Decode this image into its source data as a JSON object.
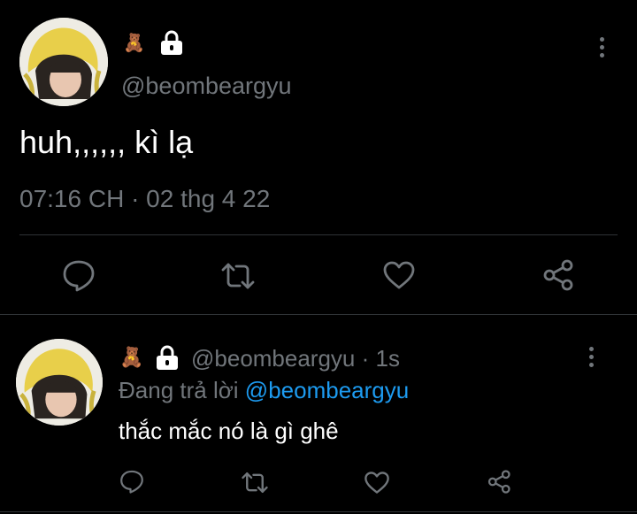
{
  "tweet": {
    "author_emoji": "🧸",
    "lock_icon": "lock-icon",
    "handle": "@beombeargyu",
    "text": "huh,,,,,, kì lạ",
    "timestamp": "07:16 CH · 02 thg 4 22"
  },
  "actions": [
    "reply-icon",
    "retweet-icon",
    "like-icon",
    "share-icon"
  ],
  "reply": {
    "author_emoji": "🧸",
    "handle": "@beombeargyu",
    "separator": "·",
    "age": "1s",
    "replying_prefix": "Đang trả lời",
    "replying_to": "@beombeargyu",
    "text": "thắc mắc nó là gì ghê"
  },
  "colors": {
    "background": "#000000",
    "text": "#e7e9ea",
    "muted": "#71767b",
    "link": "#1d9bf0"
  }
}
